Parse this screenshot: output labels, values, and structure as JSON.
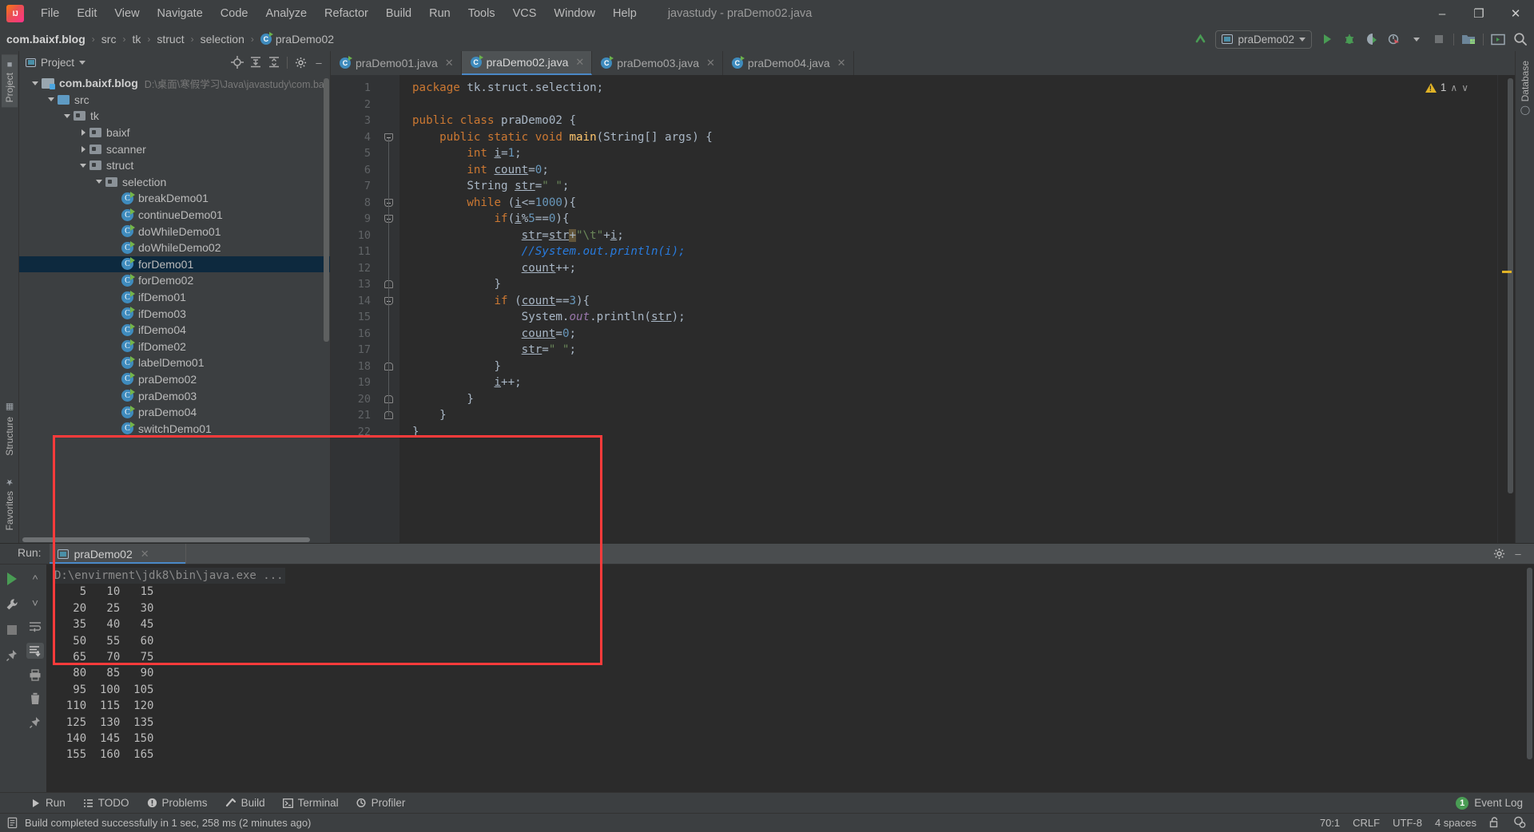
{
  "titlebar": {
    "app_icon": "intellij-logo",
    "menu": [
      {
        "label": "File",
        "mnemonic": "F"
      },
      {
        "label": "Edit",
        "mnemonic": "E"
      },
      {
        "label": "View",
        "mnemonic": "V"
      },
      {
        "label": "Navigate",
        "mnemonic": "N"
      },
      {
        "label": "Code",
        "mnemonic": "C"
      },
      {
        "label": "Analyze",
        "mnemonic": "z"
      },
      {
        "label": "Refactor",
        "mnemonic": "R"
      },
      {
        "label": "Build",
        "mnemonic": "B"
      },
      {
        "label": "Run",
        "mnemonic": "u"
      },
      {
        "label": "Tools",
        "mnemonic": "T"
      },
      {
        "label": "VCS",
        "mnemonic": ""
      },
      {
        "label": "Window",
        "mnemonic": "W"
      },
      {
        "label": "Help",
        "mnemonic": "H"
      }
    ],
    "window_title": "javastudy - praDemo02.java",
    "minimize": "–",
    "maximize": "❐",
    "close": "✕"
  },
  "navbar": {
    "breadcrumbs": [
      "com.baixf.blog",
      "src",
      "tk",
      "struct",
      "selection",
      "praDemo02"
    ],
    "separator": "›",
    "run_config": "praDemo02",
    "icons": [
      "update-project-icon",
      "run-button",
      "debug-button",
      "run-with-coverage-icon",
      "profiler-icon",
      "stop-button",
      "build-project-icon",
      "terminal-icon",
      "search-everywhere-icon"
    ]
  },
  "leftstrip": {
    "project_tab": "Project",
    "structure_tab": "Structure",
    "favorites_tab": "Favorites"
  },
  "rightstrip": {
    "database_tab": "Database"
  },
  "project_panel": {
    "title": "Project",
    "toolbar_icons": [
      "locate-icon",
      "expand-all-icon",
      "collapse-all-icon",
      "settings-gear-icon",
      "hide-icon"
    ],
    "tree": [
      {
        "depth": 0,
        "arrow": "down",
        "icon": "module",
        "label": "com.baixf.blog",
        "bold": true,
        "path": "D:\\桌面\\寒假学习\\Java\\javastudy\\com.baixf.b",
        "selected": false
      },
      {
        "depth": 1,
        "arrow": "down",
        "icon": "folder-src",
        "label": "src",
        "bold": false,
        "path": "",
        "selected": false
      },
      {
        "depth": 2,
        "arrow": "down",
        "icon": "folder-pkg",
        "label": "tk",
        "bold": false,
        "path": "",
        "selected": false
      },
      {
        "depth": 3,
        "arrow": "right",
        "icon": "folder-pkg",
        "label": "baixf",
        "bold": false,
        "path": "",
        "selected": false
      },
      {
        "depth": 3,
        "arrow": "right",
        "icon": "folder-pkg",
        "label": "scanner",
        "bold": false,
        "path": "",
        "selected": false
      },
      {
        "depth": 3,
        "arrow": "down",
        "icon": "folder-pkg",
        "label": "struct",
        "bold": false,
        "path": "",
        "selected": false
      },
      {
        "depth": 4,
        "arrow": "down",
        "icon": "folder-pkg",
        "label": "selection",
        "bold": false,
        "path": "",
        "selected": false
      },
      {
        "depth": 5,
        "arrow": "",
        "icon": "java-class",
        "label": "breakDemo01",
        "bold": false,
        "path": "",
        "selected": false
      },
      {
        "depth": 5,
        "arrow": "",
        "icon": "java-class",
        "label": "continueDemo01",
        "bold": false,
        "path": "",
        "selected": false
      },
      {
        "depth": 5,
        "arrow": "",
        "icon": "java-class",
        "label": "doWhileDemo01",
        "bold": false,
        "path": "",
        "selected": false
      },
      {
        "depth": 5,
        "arrow": "",
        "icon": "java-class",
        "label": "doWhileDemo02",
        "bold": false,
        "path": "",
        "selected": false
      },
      {
        "depth": 5,
        "arrow": "",
        "icon": "java-class",
        "label": "forDemo01",
        "bold": false,
        "path": "",
        "selected": true
      },
      {
        "depth": 5,
        "arrow": "",
        "icon": "java-class",
        "label": "forDemo02",
        "bold": false,
        "path": "",
        "selected": false
      },
      {
        "depth": 5,
        "arrow": "",
        "icon": "java-class",
        "label": "ifDemo01",
        "bold": false,
        "path": "",
        "selected": false
      },
      {
        "depth": 5,
        "arrow": "",
        "icon": "java-class",
        "label": "ifDemo03",
        "bold": false,
        "path": "",
        "selected": false
      },
      {
        "depth": 5,
        "arrow": "",
        "icon": "java-class",
        "label": "ifDemo04",
        "bold": false,
        "path": "",
        "selected": false
      },
      {
        "depth": 5,
        "arrow": "",
        "icon": "java-class",
        "label": "ifDome02",
        "bold": false,
        "path": "",
        "selected": false
      },
      {
        "depth": 5,
        "arrow": "",
        "icon": "java-class",
        "label": "labelDemo01",
        "bold": false,
        "path": "",
        "selected": false
      },
      {
        "depth": 5,
        "arrow": "",
        "icon": "java-class",
        "label": "praDemo02",
        "bold": false,
        "path": "",
        "selected": false
      },
      {
        "depth": 5,
        "arrow": "",
        "icon": "java-class",
        "label": "praDemo03",
        "bold": false,
        "path": "",
        "selected": false
      },
      {
        "depth": 5,
        "arrow": "",
        "icon": "java-class",
        "label": "praDemo04",
        "bold": false,
        "path": "",
        "selected": false
      },
      {
        "depth": 5,
        "arrow": "",
        "icon": "java-class",
        "label": "switchDemo01",
        "bold": false,
        "path": "",
        "selected": false
      }
    ]
  },
  "editor": {
    "tabs": [
      {
        "label": "praDemo01.java",
        "active": false
      },
      {
        "label": "praDemo02.java",
        "active": true
      },
      {
        "label": "praDemo03.java",
        "active": false
      },
      {
        "label": "praDemo04.java",
        "active": false
      }
    ],
    "close_glyph": "✕",
    "inspection_count": "1",
    "inspection_up": "∧",
    "inspection_down": "∨",
    "lines": [
      {
        "n": "1",
        "html": "<span class='kw'>package</span> tk.struct.selection;",
        "run": false,
        "fold": ""
      },
      {
        "n": "2",
        "html": "",
        "run": false,
        "fold": ""
      },
      {
        "n": "3",
        "html": "<span class='kw'>public class</span> praDemo02 {",
        "run": true,
        "fold": ""
      },
      {
        "n": "4",
        "html": "    <span class='kw'>public static void</span> <span style='color:#ffc66d'>main</span>(String[] args) {",
        "run": true,
        "fold": "start"
      },
      {
        "n": "5",
        "html": "        <span class='kw'>int</span> <span class='var'>i</span>=<span class='num'>1</span>;",
        "run": false,
        "fold": ""
      },
      {
        "n": "6",
        "html": "        <span class='kw'>int</span> <span class='var'>count</span>=<span class='num'>0</span>;",
        "run": false,
        "fold": ""
      },
      {
        "n": "7",
        "html": "        String <span class='var'>str</span>=<span class='str'>\" \"</span>;",
        "run": false,
        "fold": ""
      },
      {
        "n": "8",
        "html": "        <span class='kw'>while</span> (<span class='var'>i</span>&lt;=<span class='num'>1000</span>){",
        "run": false,
        "fold": "start"
      },
      {
        "n": "9",
        "html": "            <span class='kw'>if</span>(<span class='var'>i</span>%<span class='num'>5</span>==<span class='num'>0</span>){",
        "run": false,
        "fold": "start"
      },
      {
        "n": "10",
        "html": "                <span class='var'>str</span>=<span class='var'>str</span><span class='hl'>+</span><span class='str'>\"\\t\"</span>+<span class='var'>i</span>;",
        "run": false,
        "fold": ""
      },
      {
        "n": "11",
        "html": "                <span class='cmt'>//System.out.println(i);</span>",
        "run": false,
        "fold": ""
      },
      {
        "n": "12",
        "html": "                <span class='var'>count</span>++;",
        "run": false,
        "fold": ""
      },
      {
        "n": "13",
        "html": "            }",
        "run": false,
        "fold": "end"
      },
      {
        "n": "14",
        "html": "            <span class='kw'>if</span> (<span class='var'>count</span>==<span class='num'>3</span>){",
        "run": false,
        "fold": "start"
      },
      {
        "n": "15",
        "html": "                System.<span class='fld'>out</span>.println(<span class='var'>str</span>);",
        "run": false,
        "fold": ""
      },
      {
        "n": "16",
        "html": "                <span class='var'>count</span>=<span class='num'>0</span>;",
        "run": false,
        "fold": ""
      },
      {
        "n": "17",
        "html": "                <span class='var'>str</span>=<span class='str'>\" \"</span>;",
        "run": false,
        "fold": ""
      },
      {
        "n": "18",
        "html": "            }",
        "run": false,
        "fold": "end"
      },
      {
        "n": "19",
        "html": "            <span class='var'>i</span>++;",
        "run": false,
        "fold": ""
      },
      {
        "n": "20",
        "html": "        }",
        "run": false,
        "fold": "end"
      },
      {
        "n": "21",
        "html": "    }",
        "run": false,
        "fold": "end"
      },
      {
        "n": "22",
        "html": "}",
        "run": false,
        "fold": ""
      }
    ]
  },
  "run_panel": {
    "label": "Run:",
    "tab_title": "praDemo02",
    "close_glyph": "✕",
    "settings_icon": "gear-icon",
    "hide_icon": "–",
    "tool_icons": [
      "rerun-icon",
      "wrench-icon",
      "stop-icon",
      "up-arrow-icon",
      "down-arrow-icon",
      "soft-wrap-icon",
      "scroll-to-end-icon",
      "print-icon",
      "trash-icon",
      "pin-icon"
    ],
    "command_line": "D:\\envirment\\jdk8\\bin\\java.exe ...",
    "output": [
      "    5   10   15",
      "   20   25   30",
      "   35   40   45",
      "   50   55   60",
      "   65   70   75",
      "   80   85   90",
      "   95  100  105",
      "  110  115  120",
      "  125  130  135",
      "  140  145  150",
      "  155  160  165"
    ]
  },
  "bottom_bar": {
    "tabs": [
      {
        "label": "Run",
        "icon": "run-icon"
      },
      {
        "label": "TODO",
        "icon": "todo-icon"
      },
      {
        "label": "Problems",
        "icon": "problems-icon"
      },
      {
        "label": "Build",
        "icon": "build-icon"
      },
      {
        "label": "Terminal",
        "icon": "terminal-icon"
      },
      {
        "label": "Profiler",
        "icon": "profiler-icon"
      }
    ],
    "event_log": "Event Log",
    "event_count": "1"
  },
  "status_bar": {
    "message": "Build completed successfully in 1 sec, 258 ms (2 minutes ago)",
    "caret": "70:1",
    "line_sep": "CRLF",
    "encoding": "UTF-8",
    "indent": "4 spaces",
    "lock_icon": "unlocked-icon",
    "inspection_icon": "inspection-icon"
  },
  "colors": {
    "accent_blue": "#4a88c7",
    "selection_blue": "#0d293e",
    "editor_bg": "#2b2b2b",
    "chrome_bg": "#3c3f41",
    "annotation_red": "#ff3b3b",
    "keyword_orange": "#cc7832",
    "string_green": "#6a8759",
    "number_blue": "#6897bb",
    "comment_blue": "#287bde",
    "green_run": "#499c54"
  }
}
